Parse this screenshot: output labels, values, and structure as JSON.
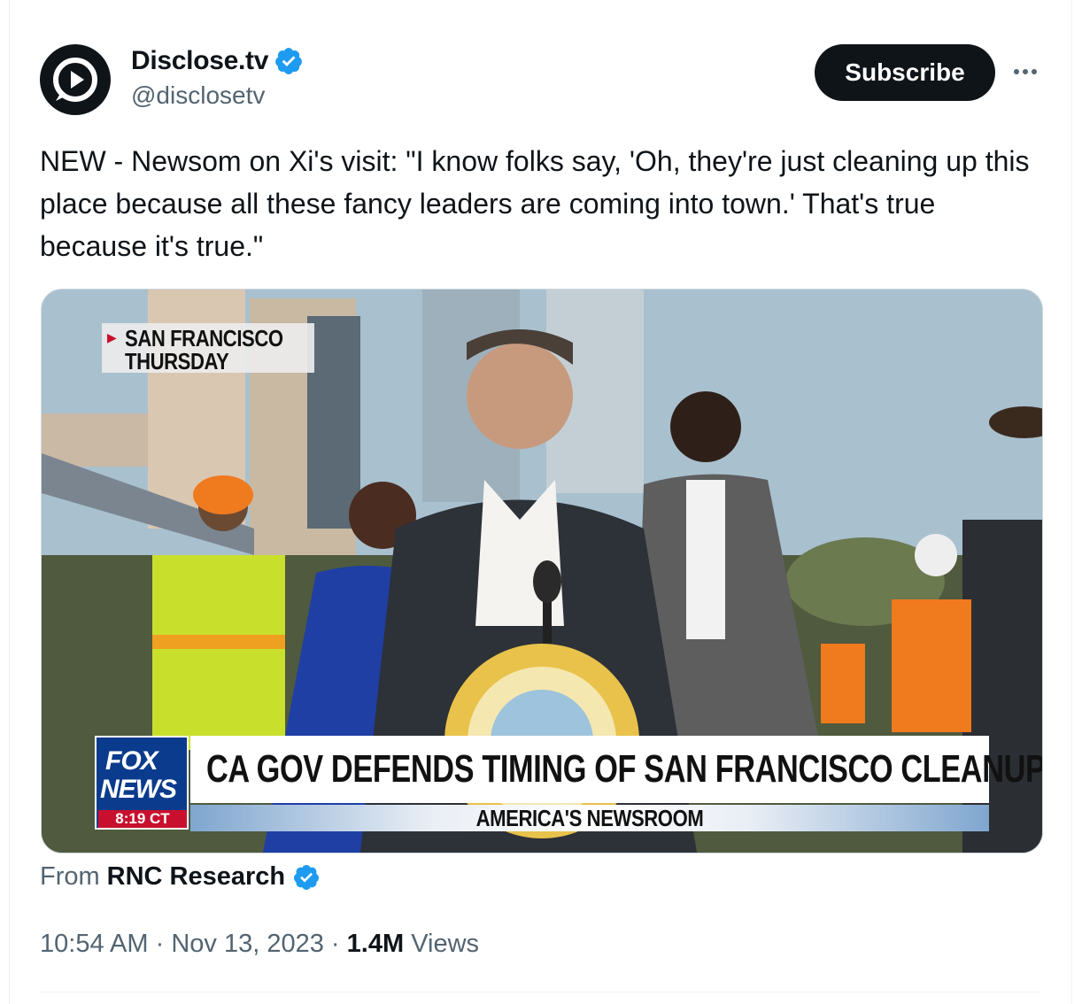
{
  "author": {
    "display_name": "Disclose.tv",
    "handle": "@disclosetv",
    "verified": true,
    "avatar_icon": "play-bubble-icon"
  },
  "actions": {
    "subscribe_label": "Subscribe",
    "more_icon": "more-dots-icon"
  },
  "tweet": {
    "text": "NEW - Newsom on Xi's visit: \"I know folks say, 'Oh, they're just cleaning up this place because all these fancy leaders are coming into town.' That's true because it's true.\""
  },
  "media": {
    "location_line1": "SAN FRANCISCO",
    "location_line2": "THURSDAY",
    "network_logo_line1": "FOX",
    "network_logo_line2": "NEWS",
    "broadcast_time": "8:19 CT",
    "headline": "CA GOV DEFENDS TIMING OF SAN FRANCISCO CLEANUP",
    "show_name": "AMERICA'S NEWSROOM"
  },
  "source": {
    "prefix": "From",
    "name": "RNC Research",
    "verified": true
  },
  "meta": {
    "time": "10:54 AM",
    "separator": "·",
    "date": "Nov 13, 2023",
    "views_count": "1.4M",
    "views_label": "Views"
  },
  "colors": {
    "verified_blue": "#1d9bf0",
    "text_primary": "#0f1419",
    "text_secondary": "#536471",
    "button_dark": "#0f1419",
    "fox_blue": "#0b3b8c",
    "fox_red": "#c8102e"
  }
}
